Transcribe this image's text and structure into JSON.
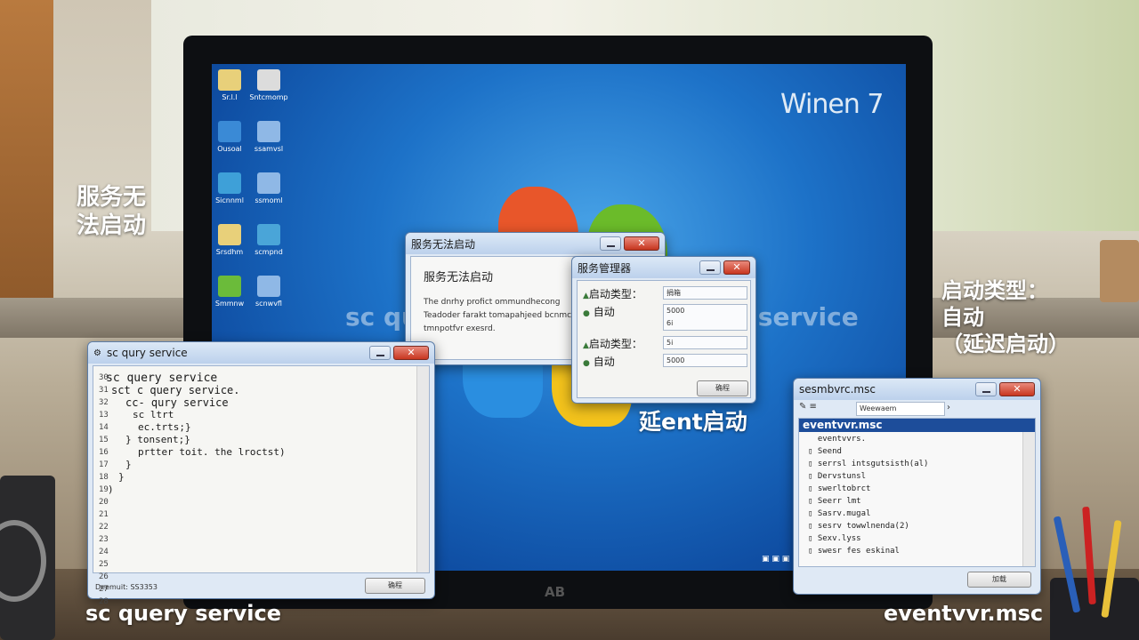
{
  "screen": {
    "os_label": "Winen 7",
    "monitor_brand": "AB"
  },
  "desktop_icons": [
    {
      "label": "Sr.l.l"
    },
    {
      "label": "Sntcmomp"
    },
    {
      "label": "Ousoal"
    },
    {
      "label": "ssamvsl"
    },
    {
      "label": "Sicnnml"
    },
    {
      "label": "ssmoml"
    },
    {
      "label": "Srsdhm"
    },
    {
      "label": "scmpnd"
    },
    {
      "label": "Smmnw"
    },
    {
      "label": "scnwvfl"
    }
  ],
  "overlays": {
    "left_caption": "服务无\n法启动",
    "right_caption": "启动类型：\n自动\n（延迟启动）",
    "mid_caption": "延ent启动",
    "bottom_left": "sc query service",
    "bottom_right": "eventvvr.msc",
    "faint_left": "sc que",
    "faint_right": "sc query service"
  },
  "error_dialog": {
    "title": "服务无法启动",
    "heading": "服务无法启动",
    "body": "The dnrhy profict ommundhecong\nTeadoder farakt tomapahjeed bcnmc\ntmnpotfvr exesrd."
  },
  "services_dialog": {
    "title": "服务管理器",
    "rows": [
      {
        "label": "启动类型：",
        "value": "捐箱"
      },
      {
        "label": "自动",
        "value": "5000\n6i"
      },
      {
        "label": "启动类型：",
        "value": "5i"
      },
      {
        "label": "自动",
        "value": "5000"
      }
    ],
    "ok_label": "确程"
  },
  "cmd_window": {
    "title": "sc qury service",
    "gutter": [
      "30",
      "31",
      "32",
      "13",
      "14",
      "15",
      "16",
      "17",
      "18",
      "19",
      "20",
      "21",
      "22",
      "23",
      "24",
      "25",
      "26",
      "27",
      "28"
    ],
    "lines": [
      "sc query service",
      "sct c query service.",
      "cc- qury service",
      "sc ltrt",
      "ec.trts;}",
      "} tonsent;}",
      "prtter toit. the lroctst)",
      "}",
      "}",
      ")"
    ],
    "status": "Deemuit: SS3353",
    "button_label": "确程"
  },
  "event_window": {
    "title": "sesmbvrc.msc",
    "toolbar_field": "Weewaem",
    "selected": "eventvvr.msc",
    "items": [
      "eventvvrs.",
      "Seend",
      "serrsl intsgutsisth(al)",
      "Dervstunsl",
      "swerltobrct",
      "Seerr lmt",
      "Sasrv.mugal",
      "sesrv towwlnenda(2)",
      "Sexv.lyss",
      "swesr fes eskinal"
    ],
    "button_label": "加载"
  }
}
